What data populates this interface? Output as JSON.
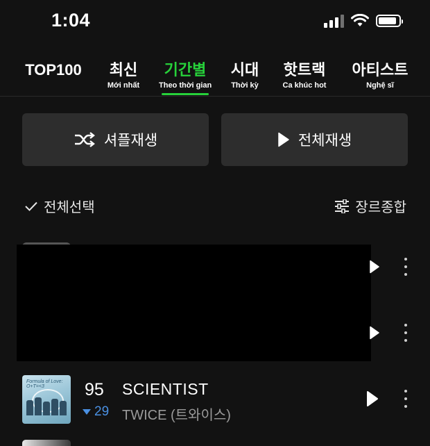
{
  "status_bar": {
    "time": "1:04",
    "battery_level": 0.9,
    "icons": [
      "signal-icon",
      "wifi-icon",
      "battery-icon"
    ]
  },
  "tabs": [
    {
      "label": "TOP100",
      "sub": ""
    },
    {
      "label": "최신",
      "sub": "Mới nhất"
    },
    {
      "label": "기간별",
      "sub": "Theo thời gian",
      "active": true
    },
    {
      "label": "시대",
      "sub": "Thời kỳ"
    },
    {
      "label": "핫트랙",
      "sub": "Ca khúc hot"
    },
    {
      "label": "아티스트",
      "sub": "Nghệ sĩ"
    }
  ],
  "accent_color": "#27d13a",
  "actions": {
    "shuffle_label": "셔플재생",
    "play_all_label": "전체재생"
  },
  "options": {
    "select_all_label": "전체선택",
    "genre_label": "장르종합"
  },
  "songs": [
    {
      "rank": "95",
      "change": "29",
      "change_direction": "down",
      "title": "SCIENTIST",
      "artist": "TWICE (트와이스)",
      "album_text": "Formula of Love: O+T=<3"
    }
  ]
}
